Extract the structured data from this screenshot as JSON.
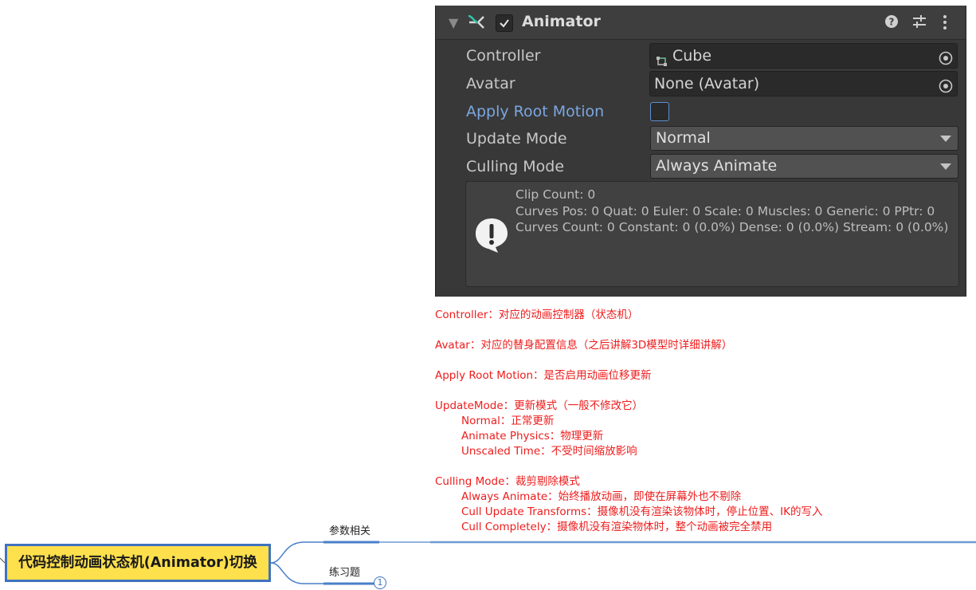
{
  "inspector": {
    "component_title": "Animator",
    "rows": {
      "controller": {
        "label": "Controller",
        "value": "Cube"
      },
      "avatar": {
        "label": "Avatar",
        "value": "None (Avatar)"
      },
      "apply_root_motion": {
        "label": "Apply Root Motion",
        "checked": false
      },
      "update_mode": {
        "label": "Update Mode",
        "value": "Normal"
      },
      "culling_mode": {
        "label": "Culling Mode",
        "value": "Always Animate"
      }
    },
    "helpbox_lines": [
      "Clip Count: 0",
      "Curves Pos: 0 Quat: 0 Euler: 0 Scale: 0 Muscles: 0 Generic: 0 PPtr: 0",
      "Curves Count: 0 Constant: 0 (0.0%) Dense: 0 (0.0%) Stream: 0 (0.0%)"
    ],
    "icons": {
      "foldout": "triangle-down-icon",
      "component": "animator-icon",
      "help": "question-icon",
      "preset": "sliders-icon",
      "menu": "kebab-menu-icon",
      "object_picker": "target-icon",
      "info": "exclamation-icon"
    },
    "colors": {
      "background": "#383838",
      "modified_label": "#7ba7e0"
    }
  },
  "notes": [
    {
      "text": "Controller：对应的动画控制器（状态机）",
      "indent": false
    },
    {
      "text": "",
      "indent": false
    },
    {
      "text": "Avatar：对应的替身配置信息（之后讲解3D模型时详细讲解）",
      "indent": false
    },
    {
      "text": "",
      "indent": false
    },
    {
      "text": "Apply Root Motion：是否启用动画位移更新",
      "indent": false
    },
    {
      "text": "",
      "indent": false
    },
    {
      "text": "UpdateMode：更新模式（一般不修改它）",
      "indent": false
    },
    {
      "text": "Normal：正常更新",
      "indent": true
    },
    {
      "text": "Animate Physics：物理更新",
      "indent": true
    },
    {
      "text": "Unscaled Time：不受时间缩放影响",
      "indent": true
    },
    {
      "text": "",
      "indent": false
    },
    {
      "text": "Culling Mode：裁剪剔除模式",
      "indent": false
    },
    {
      "text": "Always Animate：始终播放动画，即使在屏幕外也不剔除",
      "indent": true
    },
    {
      "text": "Cull Update Transforms：摄像机没有渲染该物体时，停止位置、IK的写入",
      "indent": true
    },
    {
      "text": "Cull Completely：摄像机没有渲染物体时，整个动画被完全禁用",
      "indent": true
    }
  ],
  "mindmap": {
    "central_topic": "代码控制动画状态机(Animator)切换",
    "topics": [
      "参数相关",
      "练习题"
    ],
    "badge_count": "1",
    "colors": {
      "central_fill": "#fde04c",
      "border": "#3f72bf",
      "note_text": "#ee1c1c"
    }
  }
}
